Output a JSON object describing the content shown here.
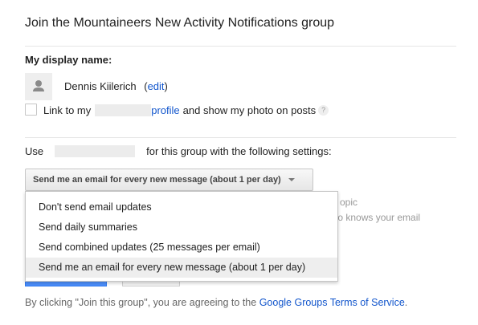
{
  "page": {
    "title": "Join the Mountaineers New Activity Notifications group"
  },
  "profile": {
    "display_name_label": "My display name:",
    "display_name": "Dennis Kiilerich",
    "edit_link": "edit",
    "link_text_before": "Link to my",
    "profile_link": "profile",
    "link_text_after": "and show my photo on posts",
    "help_glyph": "?"
  },
  "settings": {
    "use_label": "Use",
    "use_suffix": "for this group with the following settings:",
    "selected_option": "Send me an email for every new message (about 1 per day)",
    "options": [
      "Don't send email updates",
      "Send daily summaries",
      "Send combined updates (25 messages per email)",
      "Send me an email for every new message (about 1 per day)"
    ],
    "hidden_text_1": "opic",
    "hidden_text_2": "who knows your email"
  },
  "footer": {
    "prefix": "By clicking \"Join this group\", you are agreeing to the",
    "tos_link": "Google Groups Terms of Service",
    "suffix": "."
  },
  "icons": {
    "avatar": "person-icon",
    "help": "help-icon",
    "dropdown": "caret-down-icon"
  },
  "colors": {
    "link": "#1155cc",
    "primary_button": "#4d90fe",
    "menu_selected": "#eeeeee"
  }
}
